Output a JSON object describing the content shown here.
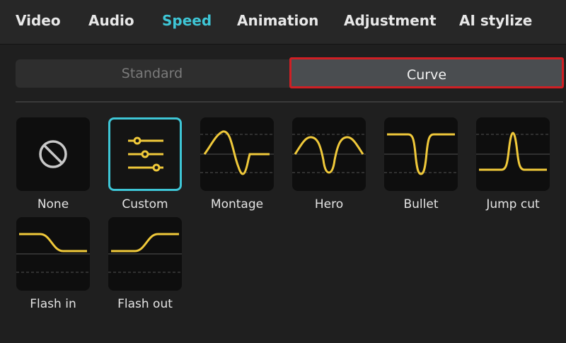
{
  "tabs": [
    {
      "label": "Video",
      "active": false
    },
    {
      "label": "Audio",
      "active": false
    },
    {
      "label": "Speed",
      "active": true
    },
    {
      "label": "Animation",
      "active": false
    },
    {
      "label": "Adjustment",
      "active": false
    },
    {
      "label": "AI stylize",
      "active": false
    }
  ],
  "segment": {
    "standard_label": "Standard",
    "curve_label": "Curve",
    "selected": "Curve"
  },
  "presets": [
    {
      "label": "None",
      "icon": "none-icon"
    },
    {
      "label": "Custom",
      "icon": "custom-sliders-icon",
      "selected": true
    },
    {
      "label": "Montage",
      "icon": "montage-curve-icon"
    },
    {
      "label": "Hero",
      "icon": "hero-curve-icon"
    },
    {
      "label": "Bullet",
      "icon": "bullet-curve-icon"
    },
    {
      "label": "Jump cut",
      "icon": "jump-cut-curve-icon"
    },
    {
      "label": "Flash in",
      "icon": "flash-in-curve-icon"
    },
    {
      "label": "Flash out",
      "icon": "flash-out-curve-icon"
    }
  ],
  "colors": {
    "accent": "#3ec6d6",
    "curve": "#f0c93a",
    "highlight_border": "#d01f24"
  }
}
